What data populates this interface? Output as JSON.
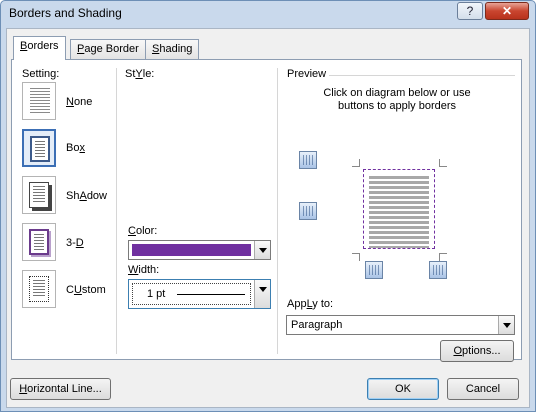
{
  "window": {
    "title": "Borders and Shading",
    "help_label": "?",
    "close_label": "✕"
  },
  "tabs": [
    {
      "label": "Borders",
      "underline": "B",
      "rest": "orders"
    },
    {
      "label": "Page Border",
      "underline": "P",
      "rest": "age Border"
    },
    {
      "label": "Shading",
      "underline": "S",
      "rest": "hading"
    }
  ],
  "setting": {
    "label": "Setting:",
    "items": [
      {
        "label": "None",
        "u": "N",
        "rest": "one"
      },
      {
        "label": "Box",
        "u": "x",
        "pre": "Bo"
      },
      {
        "label": "Shadow",
        "u": "A",
        "pre": "Sh",
        "rest2": "dow"
      },
      {
        "label": "3-D",
        "u": "D",
        "pre": "3-"
      },
      {
        "label": "Custom",
        "u": "U",
        "pre": "C",
        "rest2": "stom"
      }
    ],
    "selected": "Box"
  },
  "style": {
    "label": "Style:",
    "u": "Y",
    "pre": "St",
    "rest": "le:",
    "selected_index": 2
  },
  "color": {
    "label": "Color:",
    "u": "C",
    "rest": "olor:",
    "value": "#7030a0"
  },
  "width": {
    "label": "Width:",
    "u": "W",
    "rest": "idth:",
    "value": "1 pt"
  },
  "preview": {
    "label": "Preview",
    "instructions_line1": "Click on diagram below or use",
    "instructions_line2": "buttons to apply borders"
  },
  "apply_to": {
    "label": "Apply to:",
    "u": "L",
    "pre": "App",
    "rest": "y to:",
    "value": "Paragraph"
  },
  "buttons": {
    "options": {
      "label": "Options...",
      "u": "O",
      "rest": "ptions..."
    },
    "horizontal_line": {
      "label": "Horizontal Line...",
      "u": "H",
      "rest": "orizontal Line..."
    },
    "ok": "OK",
    "cancel": "Cancel"
  },
  "colors": {
    "accent": "#7030a0",
    "selection": "#3c6fb5"
  }
}
